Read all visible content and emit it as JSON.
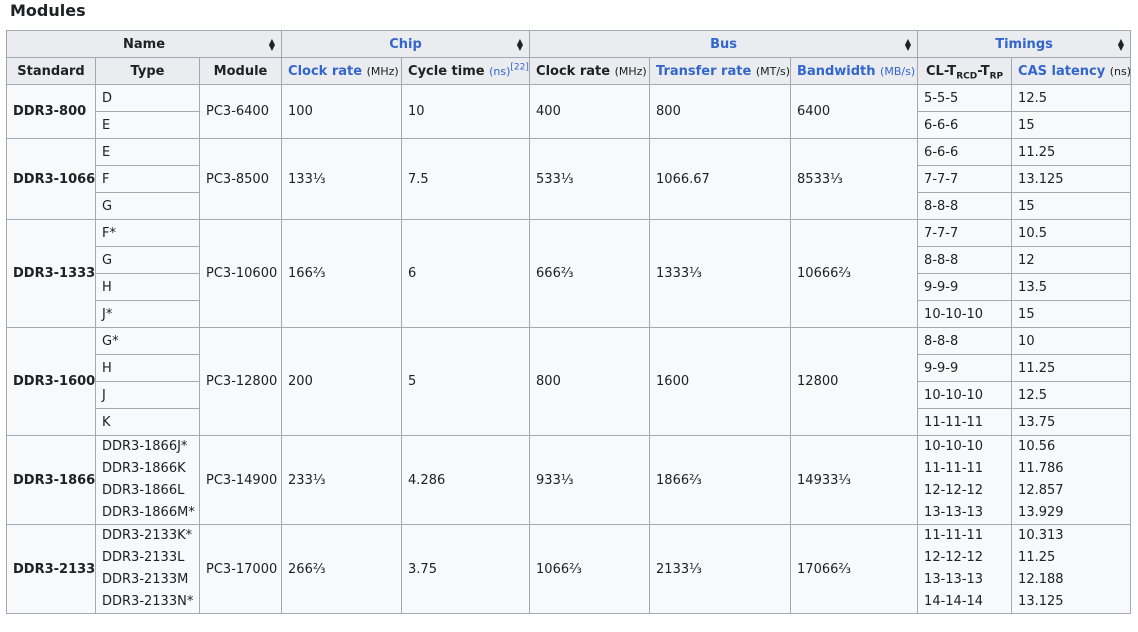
{
  "section_title": "Modules",
  "headers": {
    "name_group": "Name",
    "chip_group": "Chip",
    "bus_group": "Bus",
    "timings_group": "Timings",
    "standard": "Standard",
    "type": "Type",
    "module": "Module",
    "chip_clock": "Clock rate",
    "chip_clock_unit": "(MHz)",
    "cycle_time": "Cycle time",
    "cycle_time_unit": "(ns)",
    "cycle_time_ref": "[22]",
    "bus_clock": "Clock rate",
    "bus_clock_unit": "(MHz)",
    "transfer_rate": "Transfer rate",
    "transfer_rate_unit": "(MT/s)",
    "bandwidth": "Bandwidth",
    "bandwidth_unit": "(MB/s)",
    "timing_cl": "CL-T",
    "timing_rcd": "RCD",
    "timing_dash": "-T",
    "timing_rp": "RP",
    "cas": "CAS latency",
    "cas_unit": "(ns)"
  },
  "rows": [
    {
      "standard": "DDR3-800",
      "module": "PC3-6400",
      "chip_clock": "100",
      "cycle_time": "10",
      "bus_clock": "400",
      "transfer_rate": "800",
      "bandwidth": "6400",
      "types": [
        "D",
        "E"
      ],
      "timings": [
        "5-5-5",
        "6-6-6"
      ],
      "cas": [
        "12.5",
        "15"
      ]
    },
    {
      "standard": "DDR3-1066",
      "module": "PC3-8500",
      "chip_clock": "133⅓",
      "cycle_time": "7.5",
      "bus_clock": "533⅓",
      "transfer_rate": "1066.67",
      "bandwidth": "8533⅓",
      "types": [
        "E",
        "F",
        "G"
      ],
      "timings": [
        "6-6-6",
        "7-7-7",
        "8-8-8"
      ],
      "cas": [
        "11.25",
        "13.125",
        "15"
      ]
    },
    {
      "standard": "DDR3-1333",
      "module": "PC3-10600",
      "chip_clock": "166⅔",
      "cycle_time": "6",
      "bus_clock": "666⅔",
      "transfer_rate": "1333⅓",
      "bandwidth": "10666⅔",
      "types": [
        "F*",
        "G",
        "H",
        "J*"
      ],
      "timings": [
        "7-7-7",
        "8-8-8",
        "9-9-9",
        "10-10-10"
      ],
      "cas": [
        "10.5",
        "12",
        "13.5",
        "15"
      ]
    },
    {
      "standard": "DDR3-1600",
      "module": "PC3-12800",
      "chip_clock": "200",
      "cycle_time": "5",
      "bus_clock": "800",
      "transfer_rate": "1600",
      "bandwidth": "12800",
      "types": [
        "G*",
        "H",
        "J",
        "K"
      ],
      "timings": [
        "8-8-8",
        "9-9-9",
        "10-10-10",
        "11-11-11"
      ],
      "cas": [
        "10",
        "11.25",
        "12.5",
        "13.75"
      ]
    },
    {
      "standard": "DDR3-1866",
      "module": "PC3-14900",
      "chip_clock": "233⅓",
      "cycle_time": "4.286",
      "bus_clock": "933⅓",
      "transfer_rate": "1866⅔",
      "bandwidth": "14933⅓",
      "types": [
        "DDR3-1866J*",
        "DDR3-1866K",
        "DDR3-1866L",
        "DDR3-1866M*"
      ],
      "timings": [
        "10-10-10",
        "11-11-11",
        "12-12-12",
        "13-13-13"
      ],
      "cas": [
        "10.56",
        "11.786",
        "12.857",
        "13.929"
      ]
    },
    {
      "standard": "DDR3-2133",
      "module": "PC3-17000",
      "chip_clock": "266⅔",
      "cycle_time": "3.75",
      "bus_clock": "1066⅔",
      "transfer_rate": "2133⅓",
      "bandwidth": "17066⅔",
      "types": [
        "DDR3-2133K*",
        "DDR3-2133L",
        "DDR3-2133M",
        "DDR3-2133N*"
      ],
      "timings": [
        "11-11-11",
        "12-12-12",
        "13-13-13",
        "14-14-14"
      ],
      "cas": [
        "10.313",
        "11.25",
        "12.188",
        "13.125"
      ]
    }
  ]
}
